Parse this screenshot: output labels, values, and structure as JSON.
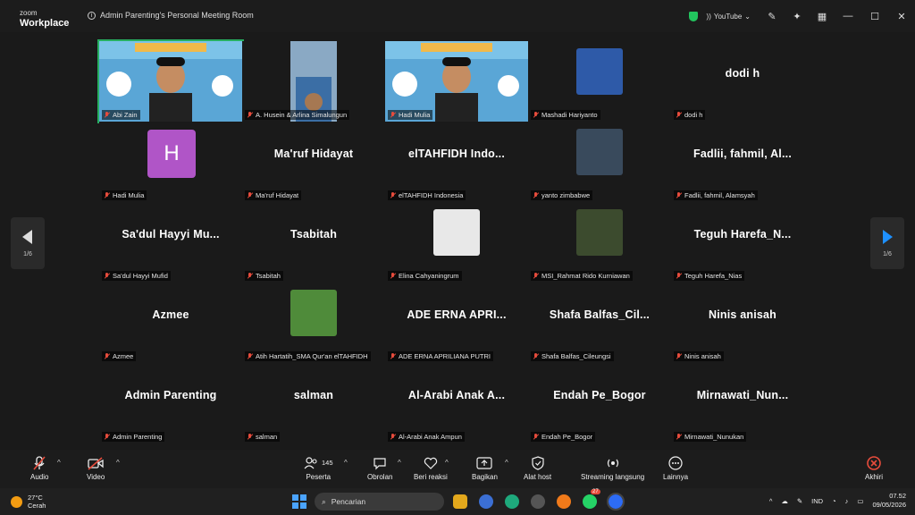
{
  "app": {
    "logo_top": "zoom",
    "logo_bottom": "Workplace",
    "meeting_title": "Admin Parenting's Personal Meeting Room"
  },
  "titlebar": {
    "youtube_label": "YouTube"
  },
  "pager": {
    "left": "1/6",
    "right": "1/6"
  },
  "tiles": [
    {
      "big": "",
      "name": "Abi Zain",
      "type": "video"
    },
    {
      "big": "",
      "name": "A. Husein & Arlina Simalungun",
      "type": "video2"
    },
    {
      "big": "",
      "name": "Hadi Mulia",
      "type": "video"
    },
    {
      "big": "",
      "name": "Mashadi Hariyanto",
      "type": "thumb"
    },
    {
      "big": "dodi h",
      "name": "dodi h",
      "type": "text"
    },
    {
      "big": "H",
      "name": "Hadi Mulia",
      "type": "avatar"
    },
    {
      "big": "Ma'ruf Hidayat",
      "name": "Ma'ruf Hidayat",
      "type": "text"
    },
    {
      "big": "elTAHFIDH Indo...",
      "name": "elTAHFIDH Indonesia",
      "type": "text"
    },
    {
      "big": "",
      "name": "yanto zimbabwe",
      "type": "thumb"
    },
    {
      "big": "Fadlii, fahmil, Al...",
      "name": "Fadlii, fahmil, Alamsyah",
      "type": "text"
    },
    {
      "big": "Sa'dul Hayyi Mu...",
      "name": "Sa'dul Hayyi Mufid",
      "type": "text"
    },
    {
      "big": "Tsabitah",
      "name": "Tsabitah",
      "type": "text"
    },
    {
      "big": "",
      "name": "Elina Cahyaningrum",
      "type": "thumb"
    },
    {
      "big": "",
      "name": "MSI_Rahmat Rido Kurniawan",
      "type": "thumb"
    },
    {
      "big": "Teguh Harefa_N...",
      "name": "Teguh Harefa_Nias",
      "type": "text"
    },
    {
      "big": "Azmee",
      "name": "Azmee",
      "type": "text"
    },
    {
      "big": "",
      "name": "Atih Hartatih_SMA Qur'an elTAHFIDH",
      "type": "thumb"
    },
    {
      "big": "ADE ERNA APRI...",
      "name": "ADE ERNA APRILIANA PUTRI",
      "type": "text"
    },
    {
      "big": "Shafa Balfas_Cil...",
      "name": "Shafa Balfas_Cileungsi",
      "type": "text"
    },
    {
      "big": "Ninis anisah",
      "name": "Ninis anisah",
      "type": "text"
    },
    {
      "big": "Admin Parenting",
      "name": "Admin Parenting",
      "type": "text"
    },
    {
      "big": "salman",
      "name": "salman",
      "type": "text"
    },
    {
      "big": "Al-Arabi Anak A...",
      "name": "Al-Arabi Anak Ampun",
      "type": "text"
    },
    {
      "big": "Endah Pe_Bogor",
      "name": "Endah Pe_Bogor",
      "type": "text"
    },
    {
      "big": "Mirnawati_Nun...",
      "name": "Mirnawati_Nunukan",
      "type": "text"
    }
  ],
  "toolbar": {
    "audio": "Audio",
    "video": "Video",
    "participants": "Peserta",
    "participants_count": "145",
    "chat": "Obrolan",
    "react": "Beri reaksi",
    "share": "Bagikan",
    "host_tools": "Alat host",
    "streaming": "Streaming langsung",
    "more": "Lainnya",
    "end": "Akhiri"
  },
  "taskbar": {
    "temperature": "27°C",
    "weather": "Cerah",
    "search": "Pencarian",
    "lang": "IND",
    "time": "07.52",
    "date": "09/05/2026",
    "whatsapp_badge": "27"
  }
}
